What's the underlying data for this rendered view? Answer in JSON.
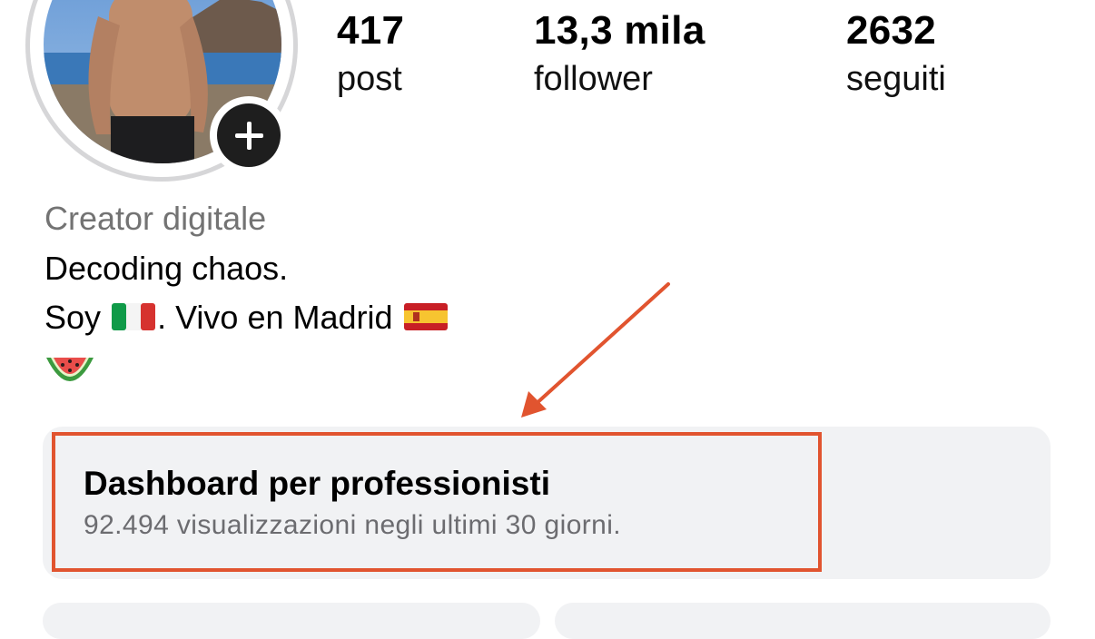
{
  "profile": {
    "stats": [
      {
        "value": "417",
        "label": "post"
      },
      {
        "value": "13,3 mila",
        "label": "follower"
      },
      {
        "value": "2632",
        "label": "seguiti"
      }
    ],
    "category": "Creator digitale",
    "bio": {
      "line1": "Decoding chaos.",
      "line2_pre": "Soy",
      "line2_mid": ". Vivo en Madrid",
      "line3_emoji": "watermelon-emoji"
    },
    "icons": {
      "add_story": "plus-icon",
      "flag_italy": "italy-flag-emoji",
      "flag_spain": "spain-flag-emoji"
    }
  },
  "dashboard": {
    "title": "Dashboard per professionisti",
    "subtitle": "92.494 visualizzazioni negli ultimi 30 giorni."
  },
  "colors": {
    "annotation": "#e1542f",
    "card_bg": "#f1f2f4",
    "muted_text": "#737373"
  }
}
